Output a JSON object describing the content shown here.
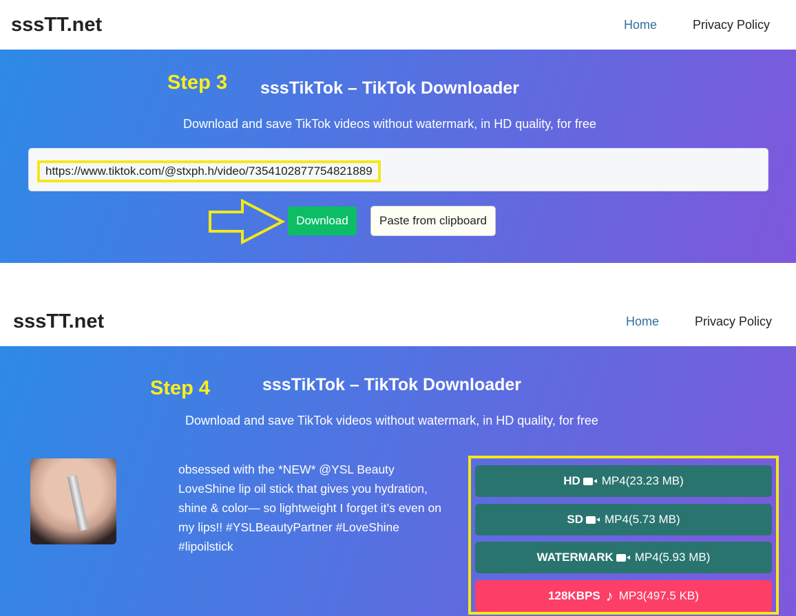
{
  "header": {
    "logo": "sssTT.net",
    "nav": [
      {
        "label": "Home"
      },
      {
        "label": "Privacy Policy"
      }
    ]
  },
  "step3": {
    "annotation": "Step 3",
    "title": "sssTikTok – TikTok Downloader",
    "subtitle": "Download and save TikTok videos without watermark, in HD quality, for free",
    "url_value": "https://www.tiktok.com/@stxph.h/video/7354102877754821889",
    "download_label": "Download",
    "paste_label": "Paste from clipboard"
  },
  "step4": {
    "annotation": "Step 4",
    "title": "sssTikTok – TikTok Downloader",
    "subtitle": "Download and save TikTok videos without watermark, in HD quality, for free",
    "description": "obsessed with the *NEW* @YSL Beauty LoveShine lip oil stick that gives you hydration, shine & color— so lightweight I forget it’s even on my lips!! #YSLBeautyPartner #LoveShine #lipoilstick",
    "downloads": [
      {
        "quality": "HD",
        "icon": "video-camera-icon",
        "format": "MP4(23.23 MB)"
      },
      {
        "quality": "SD",
        "icon": "video-camera-icon",
        "format": "MP4(5.73 MB)"
      },
      {
        "quality": "WATERMARK",
        "icon": "video-camera-icon",
        "format": "MP4(5.93 MB)"
      },
      {
        "quality": "128KBPS",
        "icon": "music-note-icon",
        "format": "MP3(497.5 KB)"
      }
    ]
  },
  "colors": {
    "accent_green": "#0dbd66",
    "download_teal": "#2a7470",
    "mp3_red": "#fd3e66",
    "annotation_yellow": "#f4e81a"
  }
}
